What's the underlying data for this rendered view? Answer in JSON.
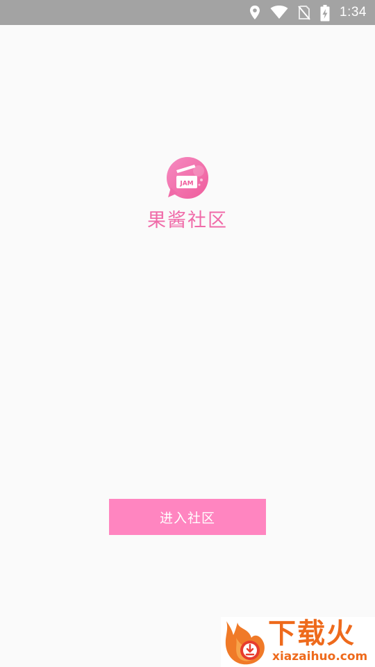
{
  "status_bar": {
    "time": "1:34",
    "icons": [
      "location-icon",
      "wifi-icon",
      "no-sim-icon",
      "battery-charging-icon"
    ]
  },
  "app": {
    "logo_text": "JAM",
    "title": "果酱社区"
  },
  "enter_button": {
    "label": "进入社区"
  },
  "watermark": {
    "brand": "下载火",
    "url": "xiazaihuo.com"
  },
  "colors": {
    "status_bar_bg": "#a3a3a3",
    "background": "#fafafa",
    "title_pink": "#f06aa8",
    "button_pink": "#ff85c0",
    "watermark_orange": "#ee6a1c"
  }
}
